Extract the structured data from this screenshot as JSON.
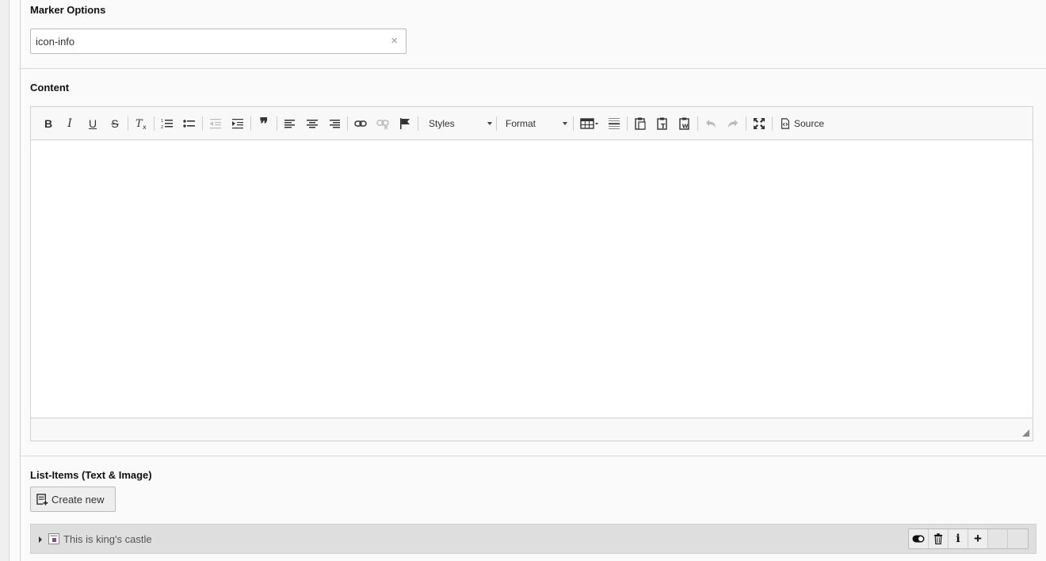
{
  "marker_options": {
    "label": "Marker Options",
    "value": "icon-info",
    "clear_icon": "×"
  },
  "content": {
    "label": "Content",
    "toolbar": {
      "styles_label": "Styles",
      "format_label": "Format",
      "source_label": "Source",
      "bold_glyph": "B",
      "italic_glyph": "I",
      "underline_glyph": "U",
      "strike_glyph": "S",
      "blockquote_glyph": "❞"
    }
  },
  "list_items": {
    "label": "List-Items (Text & Image)",
    "create_label": "Create new",
    "rows": [
      {
        "title": "This is king's castle"
      }
    ],
    "info_glyph": "i",
    "add_glyph": "+"
  },
  "colors": {
    "panel_bg": "#fafafa",
    "row_bg": "#dedede",
    "border": "#d1d1d1"
  }
}
